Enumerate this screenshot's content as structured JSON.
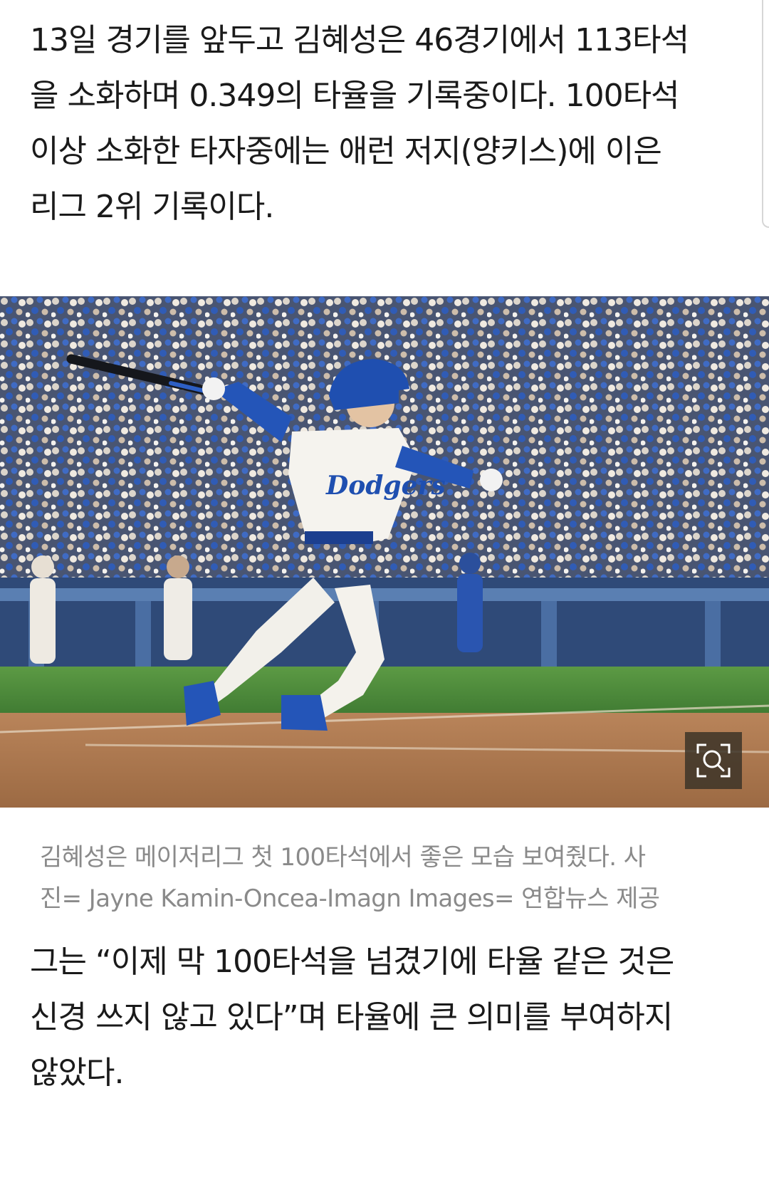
{
  "article": {
    "paragraph_1": "13일 경기를 앞두고 김혜성은 46경기에서 113타석\n을 소화하며 0.349의 타율을 기록중이다. 100타석\n이상 소화한 타자중에는 애런 저지(양키스)에 이은\n리그 2위 기록이다.",
    "photo": {
      "jersey_text": "Dodgers",
      "zoom_icon": "zoom-magnifier-icon"
    },
    "caption": "김혜성은 메이저리그 첫 100타석에서 좋은 모습 보여줬다. 사\n진= Jayne Kamin-Oncea-Imagn Images= 연합뉴스 제공",
    "paragraph_2": "그는 “이제 막 100타석을 넘겼기에 타율 같은 것은\n신경 쓰지 않고 있다”며 타율에 큰 의미를 부여하지\n않았다."
  },
  "colors": {
    "body_text": "#1a1a1a",
    "caption_text": "#8a8a8a",
    "dodger_blue": "#1f4fb0",
    "field_grass": "#4f8f3c",
    "infield_dirt": "#b07a4e"
  }
}
